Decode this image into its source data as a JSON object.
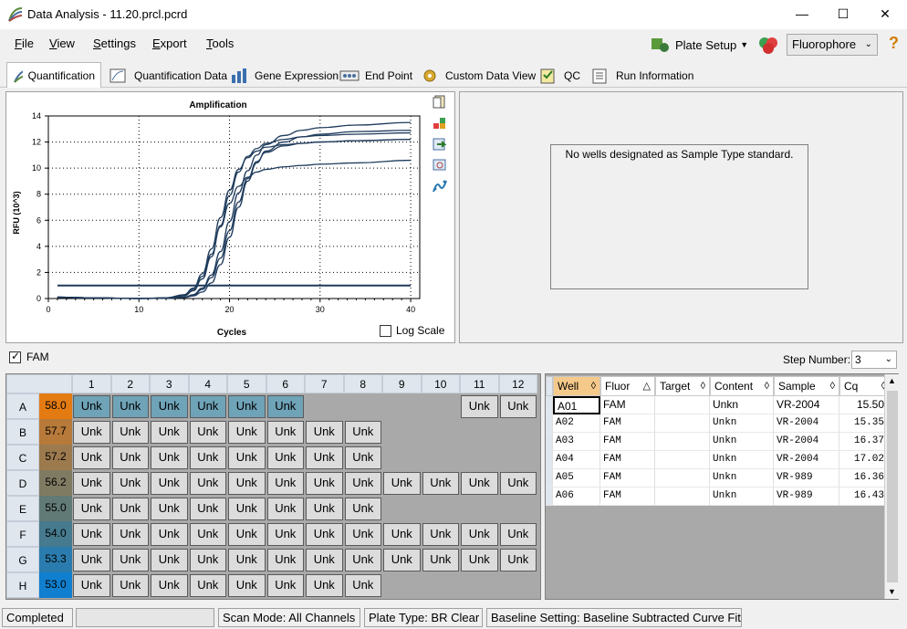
{
  "window": {
    "title": "Data Analysis - 11.20.prcl.pcrd",
    "minimize": "—",
    "maximize": "☐",
    "close": "✕"
  },
  "menu": {
    "file": "File",
    "view": "View",
    "settings": "Settings",
    "export": "Export",
    "tools": "Tools"
  },
  "toolbar": {
    "plate_setup": "Plate Setup",
    "fluorophore": "Fluorophore",
    "help": "?"
  },
  "tabs": [
    "Quantification",
    "Quantification Data",
    "Gene Expression",
    "End Point",
    "Custom Data View",
    "QC",
    "Run Information"
  ],
  "chart_data": {
    "type": "line",
    "title": "Amplification",
    "xlabel": "Cycles",
    "ylabel": "RFU (10^3)",
    "xlim": [
      0,
      41
    ],
    "ylim": [
      0,
      14
    ],
    "xticks": [
      0,
      10,
      20,
      30,
      40
    ],
    "yticks": [
      0,
      2,
      4,
      6,
      8,
      10,
      12,
      14
    ],
    "grid": true,
    "threshold": 1.0,
    "series": [
      {
        "x": [
          1,
          5,
          10,
          13,
          15,
          16,
          17,
          18,
          19,
          20,
          21,
          22,
          23,
          24,
          26,
          28,
          30,
          34,
          40
        ],
        "y": [
          0.1,
          0.05,
          0,
          0.05,
          0.3,
          0.8,
          1.9,
          3.8,
          6.2,
          8.3,
          9.9,
          10.8,
          11.3,
          11.6,
          11.8,
          11.9,
          12.0,
          12.1,
          12.2
        ]
      },
      {
        "x": [
          1,
          5,
          10,
          13,
          15,
          16,
          17,
          18,
          19,
          20,
          21,
          22,
          23,
          24,
          26,
          28,
          30,
          34,
          40
        ],
        "y": [
          0.1,
          0.05,
          0,
          0.05,
          0.2,
          0.6,
          1.5,
          3.2,
          5.6,
          7.9,
          9.7,
          10.9,
          11.5,
          11.9,
          12.2,
          12.4,
          12.5,
          12.6,
          12.7
        ]
      },
      {
        "x": [
          1,
          5,
          10,
          13,
          15,
          16,
          17,
          18,
          19,
          20,
          21,
          22,
          23,
          24,
          26,
          28,
          30,
          34,
          40
        ],
        "y": [
          0.1,
          0.05,
          0,
          0.03,
          0.1,
          0.3,
          0.8,
          1.8,
          3.6,
          5.9,
          8.1,
          9.8,
          11.0,
          11.8,
          12.5,
          12.9,
          13.1,
          13.3,
          13.5
        ]
      },
      {
        "x": [
          1,
          5,
          10,
          13,
          15,
          16,
          17,
          18,
          19,
          20,
          21,
          22,
          23,
          24,
          26,
          28,
          30,
          34,
          40
        ],
        "y": [
          0.1,
          0.05,
          0,
          0.02,
          0.08,
          0.2,
          0.5,
          1.2,
          2.6,
          4.7,
          7.0,
          9.0,
          10.4,
          11.3,
          12.0,
          12.4,
          12.6,
          12.8,
          12.9
        ]
      },
      {
        "x": [
          1,
          5,
          10,
          13,
          15,
          16,
          17,
          18,
          19,
          20,
          21,
          22,
          23,
          24,
          26,
          28,
          30,
          34,
          40
        ],
        "y": [
          0.1,
          0.05,
          0,
          0.05,
          0.25,
          0.7,
          1.7,
          3.4,
          5.5,
          7.3,
          8.6,
          9.3,
          9.7,
          9.9,
          10.1,
          10.2,
          10.3,
          10.4,
          10.6
        ]
      },
      {
        "x": [
          1,
          5,
          10,
          13,
          15,
          16,
          17,
          18,
          19,
          20,
          21,
          22,
          23,
          24,
          26,
          28,
          30,
          34,
          40
        ],
        "y": [
          0.1,
          0.05,
          0,
          0.02,
          0.1,
          0.25,
          0.7,
          1.6,
          3.1,
          5.2,
          7.4,
          9.2,
          10.5,
          11.2,
          11.7,
          11.9,
          12.0,
          12.1,
          12.2
        ]
      }
    ]
  },
  "log_scale_label": "Log Scale",
  "standard_message": "No wells designated as Sample Type standard.",
  "fam_label": "FAM",
  "step_number_label": "Step Number:",
  "step_number_value": "3",
  "plate": {
    "columns": [
      "1",
      "2",
      "3",
      "4",
      "5",
      "6",
      "7",
      "8",
      "9",
      "10",
      "11",
      "12"
    ],
    "rows": [
      {
        "label": "A",
        "temp": "58.0",
        "color": "#e47b12",
        "wells": [
          "Unk",
          "Unk",
          "Unk",
          "Unk",
          "Unk",
          "Unk",
          "",
          "",
          "",
          "",
          "Unk",
          "Unk"
        ],
        "selected": [
          true,
          true,
          true,
          true,
          true,
          true,
          false,
          false,
          false,
          false,
          false,
          false
        ]
      },
      {
        "label": "B",
        "temp": "57.7",
        "color": "#b77a3a",
        "wells": [
          "Unk",
          "Unk",
          "Unk",
          "Unk",
          "Unk",
          "Unk",
          "Unk",
          "Unk",
          "",
          "",
          "",
          ""
        ]
      },
      {
        "label": "C",
        "temp": "57.2",
        "color": "#9c7a4e",
        "wells": [
          "Unk",
          "Unk",
          "Unk",
          "Unk",
          "Unk",
          "Unk",
          "Unk",
          "Unk",
          "",
          "",
          "",
          ""
        ]
      },
      {
        "label": "D",
        "temp": "56.2",
        "color": "#7f7a62",
        "wells": [
          "Unk",
          "Unk",
          "Unk",
          "Unk",
          "Unk",
          "Unk",
          "Unk",
          "Unk",
          "Unk",
          "Unk",
          "Unk",
          "Unk"
        ]
      },
      {
        "label": "E",
        "temp": "55.0",
        "color": "#627a76",
        "wells": [
          "Unk",
          "Unk",
          "Unk",
          "Unk",
          "Unk",
          "Unk",
          "Unk",
          "Unk",
          "",
          "",
          "",
          ""
        ]
      },
      {
        "label": "F",
        "temp": "54.0",
        "color": "#467a8e",
        "wells": [
          "Unk",
          "Unk",
          "Unk",
          "Unk",
          "Unk",
          "Unk",
          "Unk",
          "Unk",
          "Unk",
          "Unk",
          "Unk",
          "Unk"
        ]
      },
      {
        "label": "G",
        "temp": "53.3",
        "color": "#2b7cae",
        "wells": [
          "Unk",
          "Unk",
          "Unk",
          "Unk",
          "Unk",
          "Unk",
          "Unk",
          "Unk",
          "Unk",
          "Unk",
          "Unk",
          "Unk"
        ]
      },
      {
        "label": "H",
        "temp": "53.0",
        "color": "#107fd0",
        "wells": [
          "Unk",
          "Unk",
          "Unk",
          "Unk",
          "Unk",
          "Unk",
          "Unk",
          "Unk",
          "",
          "",
          "",
          ""
        ]
      }
    ]
  },
  "table": {
    "headers": [
      "Well",
      "Fluor",
      "Target",
      "Content",
      "Sample",
      "Cq"
    ],
    "rows": [
      [
        "A01",
        "FAM",
        "",
        "Unkn",
        "VR-2004",
        "15.50"
      ],
      [
        "A02",
        "FAM",
        "",
        "Unkn",
        "VR-2004",
        "15.35"
      ],
      [
        "A03",
        "FAM",
        "",
        "Unkn",
        "VR-2004",
        "16.37"
      ],
      [
        "A04",
        "FAM",
        "",
        "Unkn",
        "VR-2004",
        "17.02"
      ],
      [
        "A05",
        "FAM",
        "",
        "Unkn",
        "VR-989",
        "16.36"
      ],
      [
        "A06",
        "FAM",
        "",
        "Unkn",
        "VR-989",
        "16.43"
      ]
    ]
  },
  "status": {
    "completed": "Completed",
    "scan_mode": "Scan Mode: All Channels",
    "plate_type": "Plate Type: BR Clear",
    "baseline": "Baseline Setting: Baseline Subtracted Curve Fit"
  },
  "colors": {
    "curve": "#1f3b5c",
    "threshold": "#1f3b5c",
    "selected_well": "#6fa3b8",
    "accent": "#e9a23b"
  }
}
